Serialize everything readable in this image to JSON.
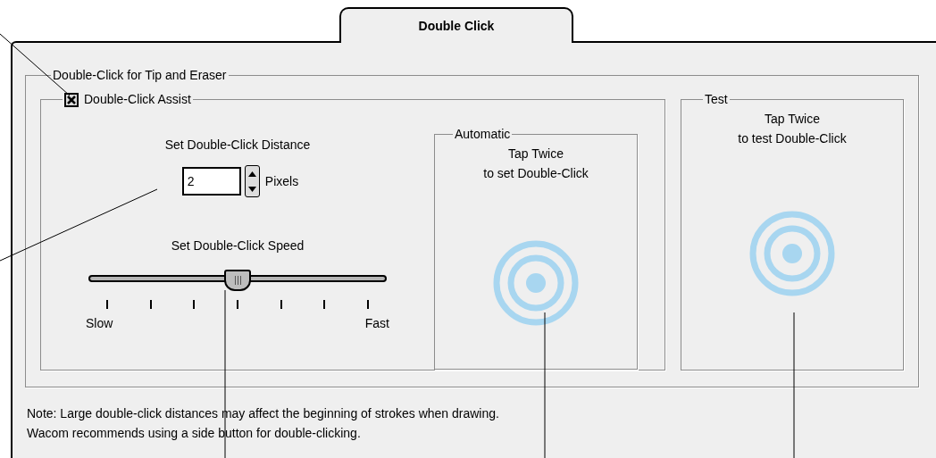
{
  "tab": {
    "label": "Double Click",
    "selected": true
  },
  "group": {
    "legend": "Double-Click for Tip and Eraser",
    "assist": {
      "label": "Double-Click Assist",
      "checked": true,
      "distance": {
        "label": "Set Double-Click Distance",
        "value": "2",
        "unit": "Pixels"
      },
      "speed": {
        "label": "Set Double-Click Speed",
        "level": 0.5,
        "min_label": "Slow",
        "max_label": "Fast"
      },
      "automatic": {
        "legend": "Automatic",
        "text": "Tap Twice\nto set Double-Click"
      }
    },
    "test": {
      "legend": "Test",
      "text": "Tap Twice\nto test Double-Click"
    }
  },
  "note": [
    "Note: Large double-click distances may affect the beginning of strokes when drawing.",
    "Wacom recommends using a side button for double-clicking."
  ]
}
